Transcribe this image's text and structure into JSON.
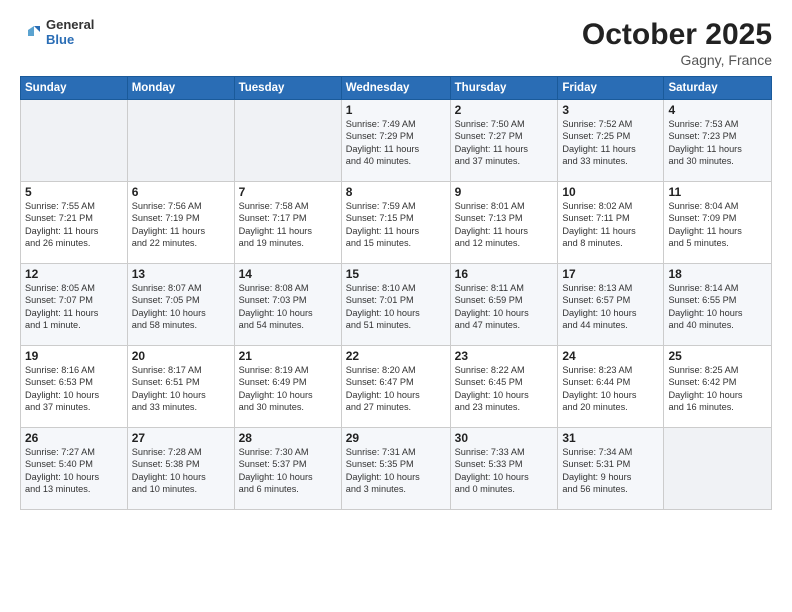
{
  "header": {
    "logo_general": "General",
    "logo_blue": "Blue",
    "month": "October 2025",
    "location": "Gagny, France"
  },
  "weekdays": [
    "Sunday",
    "Monday",
    "Tuesday",
    "Wednesday",
    "Thursday",
    "Friday",
    "Saturday"
  ],
  "weeks": [
    [
      {
        "day": "",
        "info": ""
      },
      {
        "day": "",
        "info": ""
      },
      {
        "day": "",
        "info": ""
      },
      {
        "day": "1",
        "info": "Sunrise: 7:49 AM\nSunset: 7:29 PM\nDaylight: 11 hours\nand 40 minutes."
      },
      {
        "day": "2",
        "info": "Sunrise: 7:50 AM\nSunset: 7:27 PM\nDaylight: 11 hours\nand 37 minutes."
      },
      {
        "day": "3",
        "info": "Sunrise: 7:52 AM\nSunset: 7:25 PM\nDaylight: 11 hours\nand 33 minutes."
      },
      {
        "day": "4",
        "info": "Sunrise: 7:53 AM\nSunset: 7:23 PM\nDaylight: 11 hours\nand 30 minutes."
      }
    ],
    [
      {
        "day": "5",
        "info": "Sunrise: 7:55 AM\nSunset: 7:21 PM\nDaylight: 11 hours\nand 26 minutes."
      },
      {
        "day": "6",
        "info": "Sunrise: 7:56 AM\nSunset: 7:19 PM\nDaylight: 11 hours\nand 22 minutes."
      },
      {
        "day": "7",
        "info": "Sunrise: 7:58 AM\nSunset: 7:17 PM\nDaylight: 11 hours\nand 19 minutes."
      },
      {
        "day": "8",
        "info": "Sunrise: 7:59 AM\nSunset: 7:15 PM\nDaylight: 11 hours\nand 15 minutes."
      },
      {
        "day": "9",
        "info": "Sunrise: 8:01 AM\nSunset: 7:13 PM\nDaylight: 11 hours\nand 12 minutes."
      },
      {
        "day": "10",
        "info": "Sunrise: 8:02 AM\nSunset: 7:11 PM\nDaylight: 11 hours\nand 8 minutes."
      },
      {
        "day": "11",
        "info": "Sunrise: 8:04 AM\nSunset: 7:09 PM\nDaylight: 11 hours\nand 5 minutes."
      }
    ],
    [
      {
        "day": "12",
        "info": "Sunrise: 8:05 AM\nSunset: 7:07 PM\nDaylight: 11 hours\nand 1 minute."
      },
      {
        "day": "13",
        "info": "Sunrise: 8:07 AM\nSunset: 7:05 PM\nDaylight: 10 hours\nand 58 minutes."
      },
      {
        "day": "14",
        "info": "Sunrise: 8:08 AM\nSunset: 7:03 PM\nDaylight: 10 hours\nand 54 minutes."
      },
      {
        "day": "15",
        "info": "Sunrise: 8:10 AM\nSunset: 7:01 PM\nDaylight: 10 hours\nand 51 minutes."
      },
      {
        "day": "16",
        "info": "Sunrise: 8:11 AM\nSunset: 6:59 PM\nDaylight: 10 hours\nand 47 minutes."
      },
      {
        "day": "17",
        "info": "Sunrise: 8:13 AM\nSunset: 6:57 PM\nDaylight: 10 hours\nand 44 minutes."
      },
      {
        "day": "18",
        "info": "Sunrise: 8:14 AM\nSunset: 6:55 PM\nDaylight: 10 hours\nand 40 minutes."
      }
    ],
    [
      {
        "day": "19",
        "info": "Sunrise: 8:16 AM\nSunset: 6:53 PM\nDaylight: 10 hours\nand 37 minutes."
      },
      {
        "day": "20",
        "info": "Sunrise: 8:17 AM\nSunset: 6:51 PM\nDaylight: 10 hours\nand 33 minutes."
      },
      {
        "day": "21",
        "info": "Sunrise: 8:19 AM\nSunset: 6:49 PM\nDaylight: 10 hours\nand 30 minutes."
      },
      {
        "day": "22",
        "info": "Sunrise: 8:20 AM\nSunset: 6:47 PM\nDaylight: 10 hours\nand 27 minutes."
      },
      {
        "day": "23",
        "info": "Sunrise: 8:22 AM\nSunset: 6:45 PM\nDaylight: 10 hours\nand 23 minutes."
      },
      {
        "day": "24",
        "info": "Sunrise: 8:23 AM\nSunset: 6:44 PM\nDaylight: 10 hours\nand 20 minutes."
      },
      {
        "day": "25",
        "info": "Sunrise: 8:25 AM\nSunset: 6:42 PM\nDaylight: 10 hours\nand 16 minutes."
      }
    ],
    [
      {
        "day": "26",
        "info": "Sunrise: 7:27 AM\nSunset: 5:40 PM\nDaylight: 10 hours\nand 13 minutes."
      },
      {
        "day": "27",
        "info": "Sunrise: 7:28 AM\nSunset: 5:38 PM\nDaylight: 10 hours\nand 10 minutes."
      },
      {
        "day": "28",
        "info": "Sunrise: 7:30 AM\nSunset: 5:37 PM\nDaylight: 10 hours\nand 6 minutes."
      },
      {
        "day": "29",
        "info": "Sunrise: 7:31 AM\nSunset: 5:35 PM\nDaylight: 10 hours\nand 3 minutes."
      },
      {
        "day": "30",
        "info": "Sunrise: 7:33 AM\nSunset: 5:33 PM\nDaylight: 10 hours\nand 0 minutes."
      },
      {
        "day": "31",
        "info": "Sunrise: 7:34 AM\nSunset: 5:31 PM\nDaylight: 9 hours\nand 56 minutes."
      },
      {
        "day": "",
        "info": ""
      }
    ]
  ]
}
